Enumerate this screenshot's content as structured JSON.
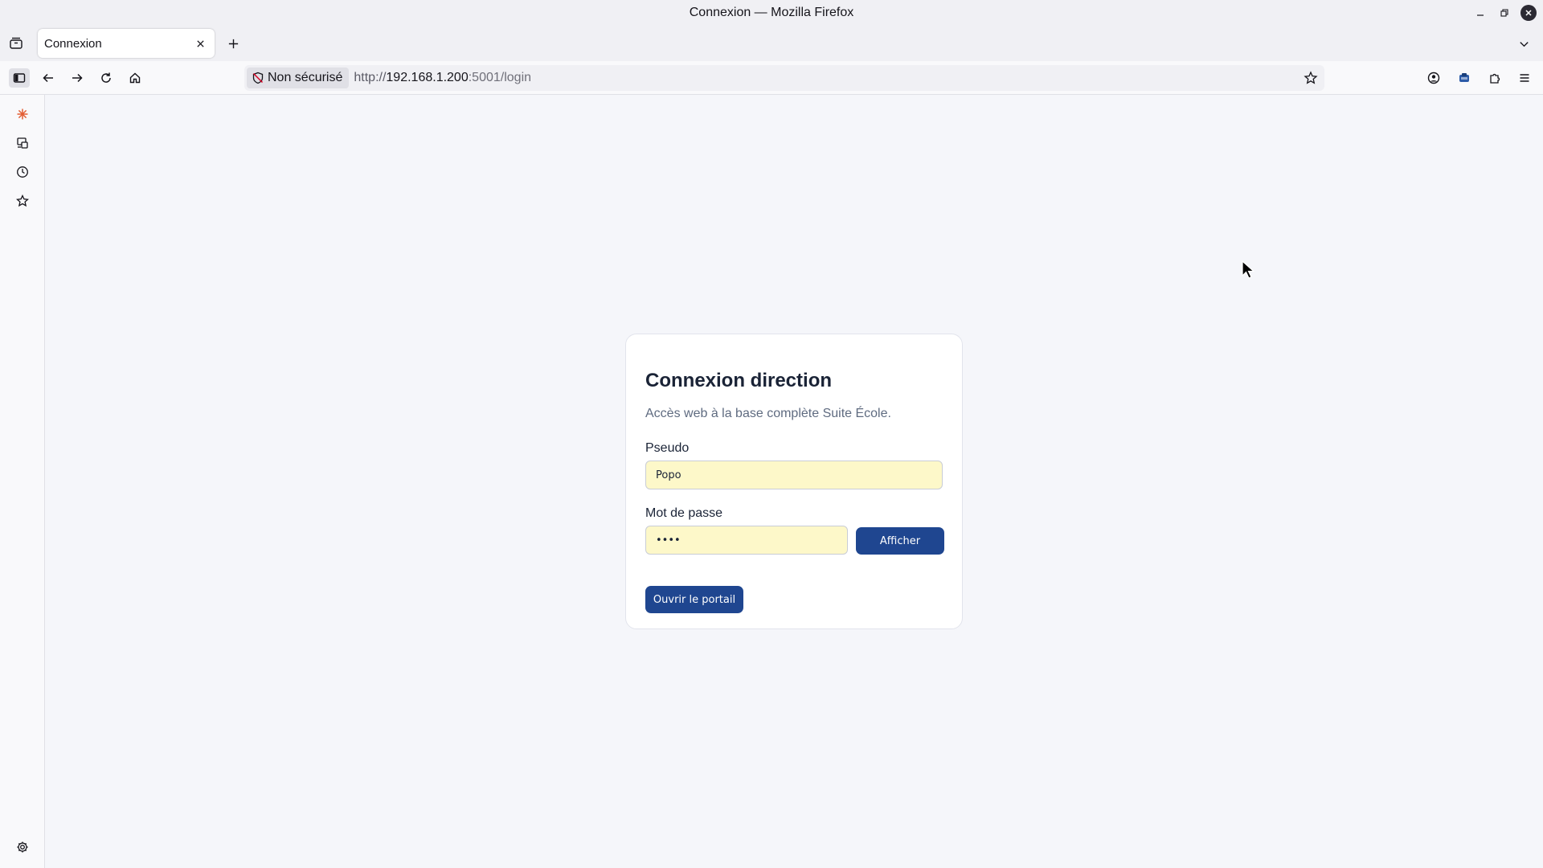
{
  "window": {
    "title": "Connexion — Mozilla Firefox"
  },
  "tabs": [
    {
      "label": "Connexion"
    }
  ],
  "urlbar": {
    "security_label": "Non sécurisé",
    "scheme": "http://",
    "host": "192.168.1.200",
    "path": ":5001/login"
  },
  "icons": {
    "list_tabs": "tab-list-icon",
    "close_tab": "close-icon",
    "new_tab": "plus-icon",
    "back": "arrow-left-icon",
    "forward": "arrow-right-icon",
    "reload": "reload-icon",
    "home": "home-icon",
    "bookmark": "star-icon",
    "account": "account-icon",
    "extensions": "puzzle-icon",
    "menu": "hamburger-icon"
  },
  "login": {
    "title": "Connexion direction",
    "subtitle": "Accès web à la base complète Suite École.",
    "username_label": "Pseudo",
    "username_value": "Popo",
    "password_label": "Mot de passe",
    "password_value": "••••",
    "show_button": "Afficher",
    "submit_button": "Ouvrir le portail"
  },
  "colors": {
    "accent": "#1f4690",
    "autofill": "#fdf8c9",
    "ai_icon": "#e25d33"
  }
}
